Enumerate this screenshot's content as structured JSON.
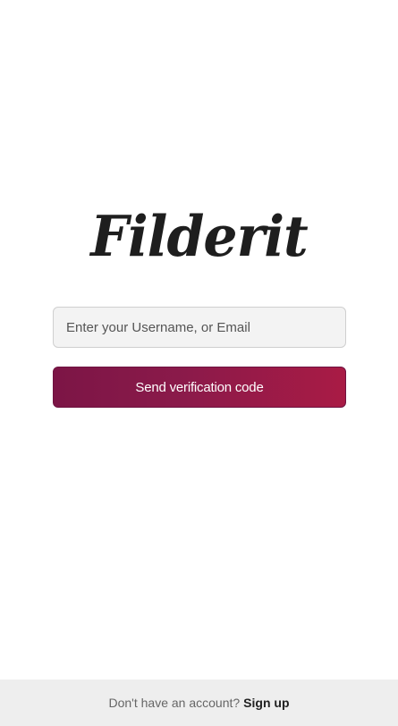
{
  "brand": {
    "logo_text": "Filderit"
  },
  "form": {
    "identity_placeholder": "Enter your Username, or Email",
    "identity_value": "",
    "send_label": "Send verification code"
  },
  "footer": {
    "prompt": "Don't have an account?",
    "signup_label": "Sign up"
  },
  "colors": {
    "accent_start": "#7c1546",
    "accent_end": "#a91b45",
    "footer_bg": "#eeeeee"
  }
}
